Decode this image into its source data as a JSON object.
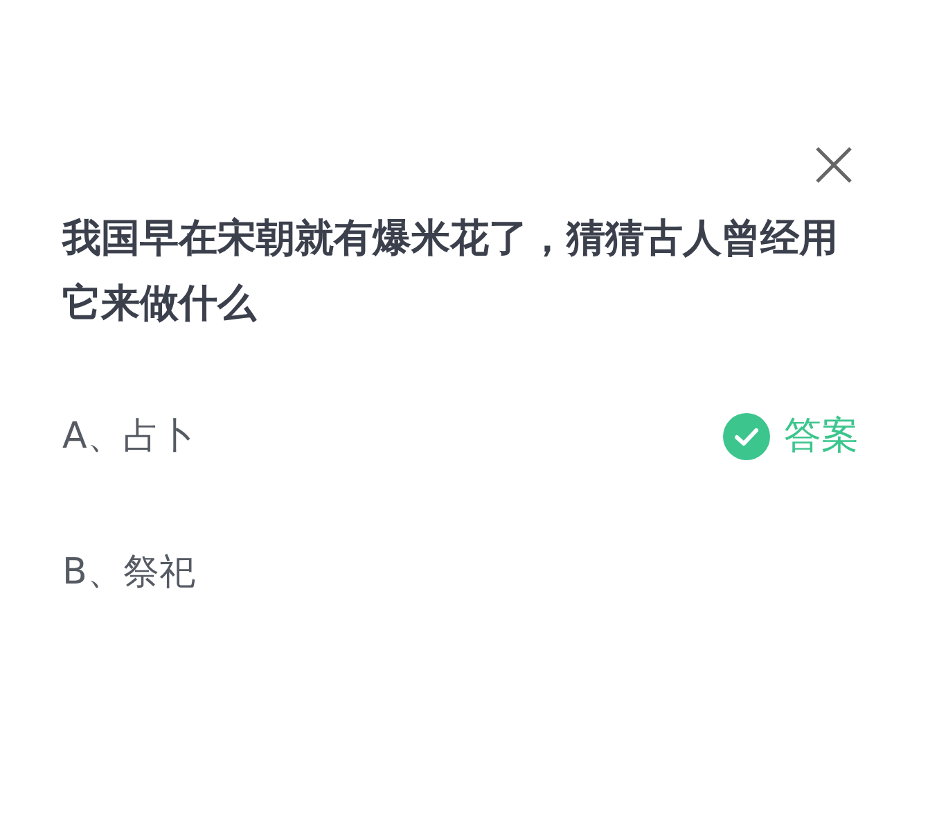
{
  "question": "我国早在宋朝就有爆米花了，猜猜古人曾经用它来做什么",
  "options": [
    {
      "label": "A、占卜",
      "correct": true
    },
    {
      "label": "B、祭祀",
      "correct": false
    }
  ],
  "answer_label": "答案"
}
